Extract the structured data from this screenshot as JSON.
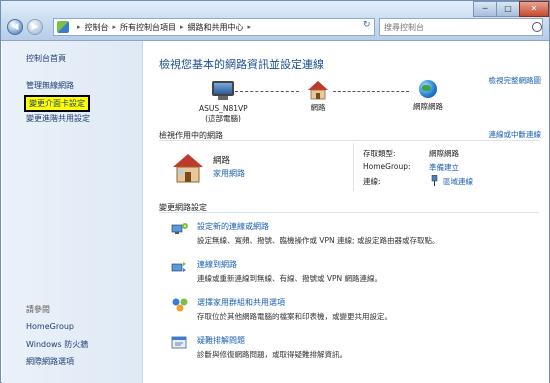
{
  "breadcrumb": [
    "控制台",
    "所有控制台項目",
    "網路和共用中心"
  ],
  "search": {
    "placeholder": "搜尋控制台"
  },
  "window": {
    "minimize": "─",
    "maximize": "□",
    "close": "✕"
  },
  "left": {
    "home": "控制台首頁",
    "links": [
      "管理無線網路",
      "變更介面卡設定",
      "變更進階共用設定"
    ],
    "see_also_label": "請參閱",
    "see_also": [
      "HomeGroup",
      "Windows 防火牆",
      "網際網路選項"
    ]
  },
  "main": {
    "title": "檢視您基本的網路資訊並設定連線",
    "full_map": "檢視完整網路圖",
    "map": {
      "computer": "ASUS_N81VP",
      "computer_sub": "(這部電腦)",
      "network": "網路",
      "internet": "網際網路"
    },
    "active_header": "檢視作用中的網路",
    "connect_link": "連線或中斷連線",
    "active": {
      "name": "網路",
      "type": "家用網路",
      "access_label": "存取類型:",
      "access_value": "網際網路",
      "homegroup_label": "HomeGroup:",
      "homegroup_value": "準備建立",
      "conn_label": "連線:",
      "conn_value": "區域連線"
    },
    "change_header": "變更網路設定",
    "tasks": [
      {
        "title": "設定新的連線或網路",
        "desc": "設定無線、寬頻、撥號、臨機操作或 VPN 連線; 或設定路由器或存取點。"
      },
      {
        "title": "連線到網路",
        "desc": "連線或重新連線到無線、有線、撥號或 VPN 網路連線。"
      },
      {
        "title": "選擇家用群組和共用選項",
        "desc": "存取位於其他網路電腦的檔案和印表機，或變更共用設定。"
      },
      {
        "title": "疑難排解問題",
        "desc": "診斷與修復網路問題，或取得疑難排解資訊。"
      }
    ]
  },
  "colors": {
    "link": "#1a5fb4",
    "title": "#1a4f91",
    "highlight": "#ffff00"
  }
}
